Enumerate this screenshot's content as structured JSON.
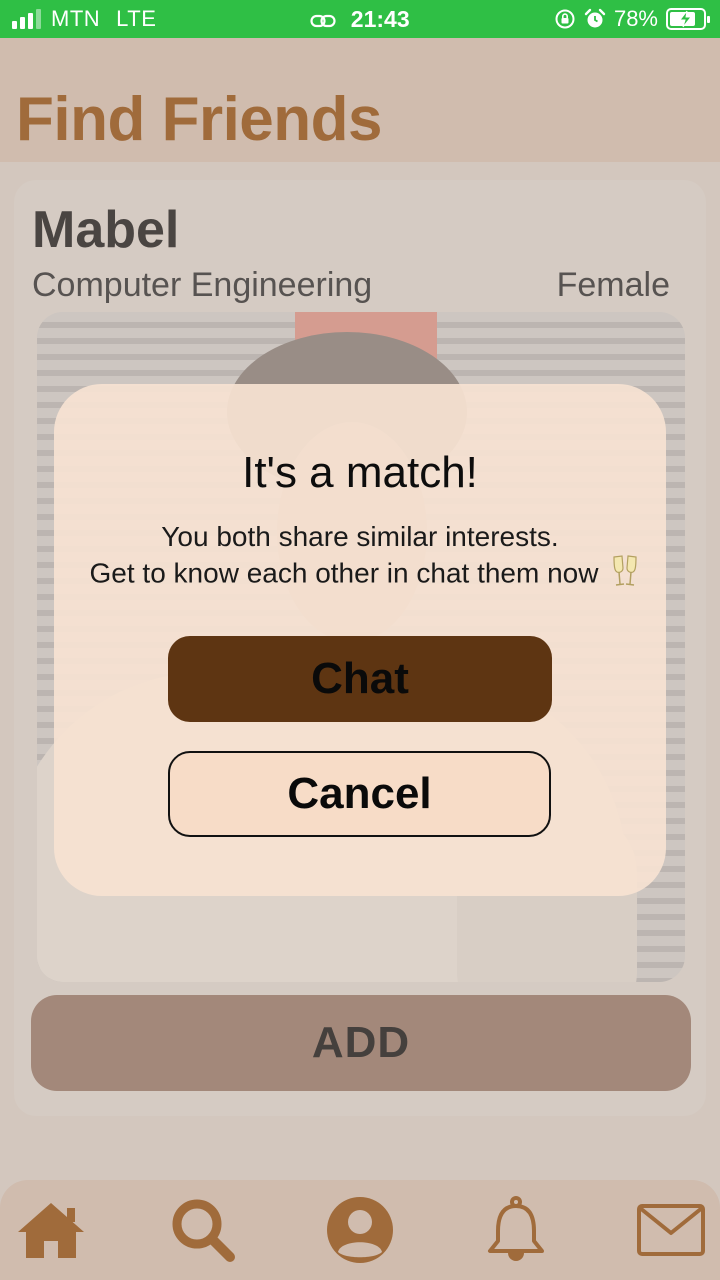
{
  "status_bar": {
    "carrier": "MTN",
    "network": "LTE",
    "time": "21:43",
    "battery_percent": "78%",
    "battery_level": 0.78,
    "icons": [
      "signal-icon",
      "link-icon",
      "rotation-lock-icon",
      "alarm-icon",
      "battery-charging-icon"
    ]
  },
  "header": {
    "title": "Find Friends"
  },
  "profile": {
    "name": "Mabel",
    "major": "Computer Engineering",
    "gender": "Female",
    "photo_icon": "profile-photo"
  },
  "add_button": {
    "label": "ADD"
  },
  "modal": {
    "title": "It's a match!",
    "message_line1": "You both share similar interests.",
    "message_line2": "Get to know each other in chat them now",
    "emoji_icon": "clinking-glasses-icon",
    "chat_label": "Chat",
    "cancel_label": "Cancel"
  },
  "bottom_nav": {
    "items": [
      "home-icon",
      "search-icon",
      "profile-icon",
      "bell-icon",
      "mail-icon"
    ]
  },
  "colors": {
    "status_bar": "#2fbf45",
    "accent": "#a06b3b",
    "header_bg": "#d0bcae",
    "chat_button": "#5e3512",
    "modal_bg": "#f6e2d2"
  }
}
